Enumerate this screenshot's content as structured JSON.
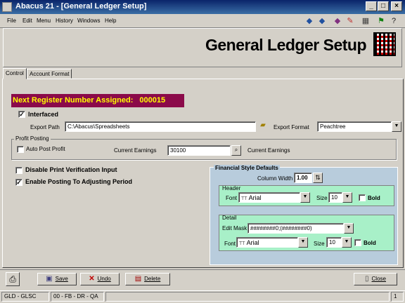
{
  "window": {
    "title": "Abacus 21 - [General Ledger Setup]"
  },
  "menu": [
    "File",
    "Edit",
    "Menu",
    "History",
    "Windows",
    "Help"
  ],
  "page_title": "General Ledger Setup",
  "tabs": [
    {
      "label": "Control",
      "active": true
    },
    {
      "label": "Account Format",
      "active": false
    }
  ],
  "banner": {
    "label": "Next Register Number Assigned:",
    "value": "000015"
  },
  "interfaced": {
    "label": "Interfaced",
    "checked": true
  },
  "export_path": {
    "label": "Export Path",
    "value": "C:\\Abacus\\Spreadsheets"
  },
  "export_format": {
    "label": "Export Format",
    "value": "Peachtree"
  },
  "profit_posting": {
    "group_label": "Profit Posting",
    "auto_post": {
      "label": "Auto Post Profit",
      "checked": false
    },
    "current_earnings_label": "Current Earnings",
    "current_earnings_value": "30100",
    "current_earnings_desc": "Current Earnings"
  },
  "disable_print": {
    "label": "Disable Print Verification Input",
    "checked": false
  },
  "enable_posting": {
    "label": "Enable Posting To Adjusting Period",
    "checked": true
  },
  "financial": {
    "title": "Financial Style Defaults",
    "column_width_label": "Column Width",
    "column_width_value": "1.00",
    "header": {
      "label": "Header",
      "font_label": "Font",
      "font_value": "Arial",
      "size_label": "Size",
      "size_value": "10",
      "bold_label": "Bold",
      "bold_checked": false
    },
    "detail": {
      "label": "Detail",
      "edit_mask_label": "Edit Mask",
      "edit_mask_value": "########0;(########0)",
      "font_label": "Font",
      "font_value": "Arial",
      "size_label": "Size",
      "size_value": "10",
      "bold_label": "Bold",
      "bold_checked": false
    }
  },
  "buttons": {
    "save": "Save",
    "undo": "Undo",
    "delete": "Delete",
    "close": "Close"
  },
  "status": {
    "cell1": "GLD - GLSC",
    "cell2": "00 - FB - DR - QA",
    "page": "1"
  },
  "icons": {
    "truetype_glyph": "TT",
    "check_glyph": "✓"
  }
}
